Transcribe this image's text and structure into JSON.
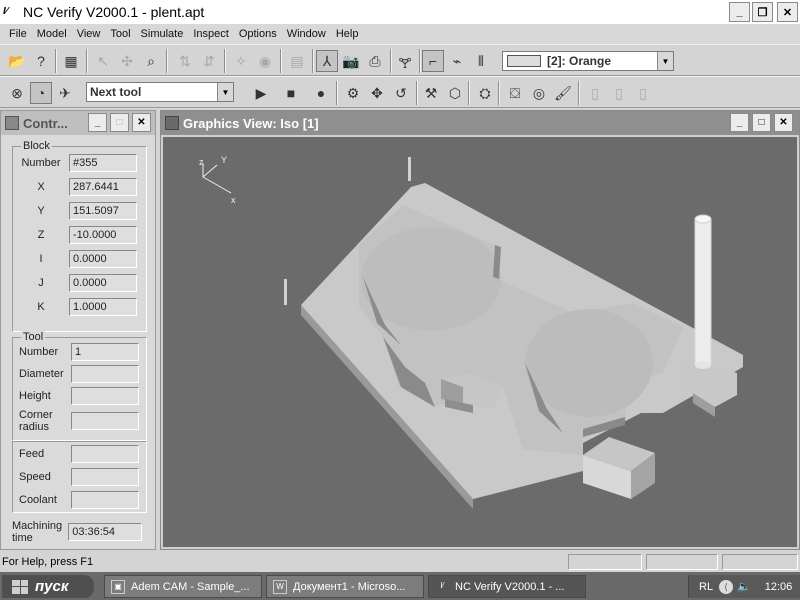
{
  "window": {
    "title": "NC Verify  V2000.1  - plent.apt",
    "app_icon": "nc-verify-icon",
    "buttons": {
      "minimize": "_",
      "maximize": "❐",
      "close": "✕"
    }
  },
  "menu": [
    "File",
    "Model",
    "View",
    "Tool",
    "Simulate",
    "Inspect",
    "Options",
    "Window",
    "Help"
  ],
  "toolbar": {
    "color_select": "[2]: Orange",
    "swatch_color": "#dcdcdc",
    "next_select": "Next tool"
  },
  "control_panel": {
    "title": "Contr...",
    "block": {
      "legend": "Block",
      "rows": [
        {
          "label": "Number",
          "value": "#355"
        },
        {
          "label": "X",
          "value": "287.6441"
        },
        {
          "label": "Y",
          "value": "151.5097"
        },
        {
          "label": "Z",
          "value": "-10.0000"
        },
        {
          "label": "I",
          "value": "0.0000"
        },
        {
          "label": "J",
          "value": "0.0000"
        },
        {
          "label": "K",
          "value": "1.0000"
        }
      ]
    },
    "tool": {
      "legend": "Tool",
      "number_label": "Number",
      "number_value": "1",
      "diameter_label": "Diameter",
      "height_label": "Height",
      "corner_label_1": "Corner",
      "corner_label_2": "radius"
    },
    "feeds": {
      "feed": "Feed",
      "speed": "Speed",
      "coolant": "Coolant"
    },
    "machining_label_1": "Machining",
    "machining_label_2": "time",
    "machining_value": "03:36:54"
  },
  "graphics": {
    "title": "Graphics View: Iso [1]",
    "axes": {
      "z": "z",
      "y": "Y",
      "x": "x"
    },
    "background": "#6b6b6b"
  },
  "status": {
    "help": "For Help, press F1"
  },
  "taskbar": {
    "start": "пуск",
    "tasks": [
      "Adem CAM - Sample_...",
      "Документ1 - Microso...",
      "NC Verify  V2000.1  - ..."
    ],
    "lang": "RL",
    "clock": "12:06"
  }
}
